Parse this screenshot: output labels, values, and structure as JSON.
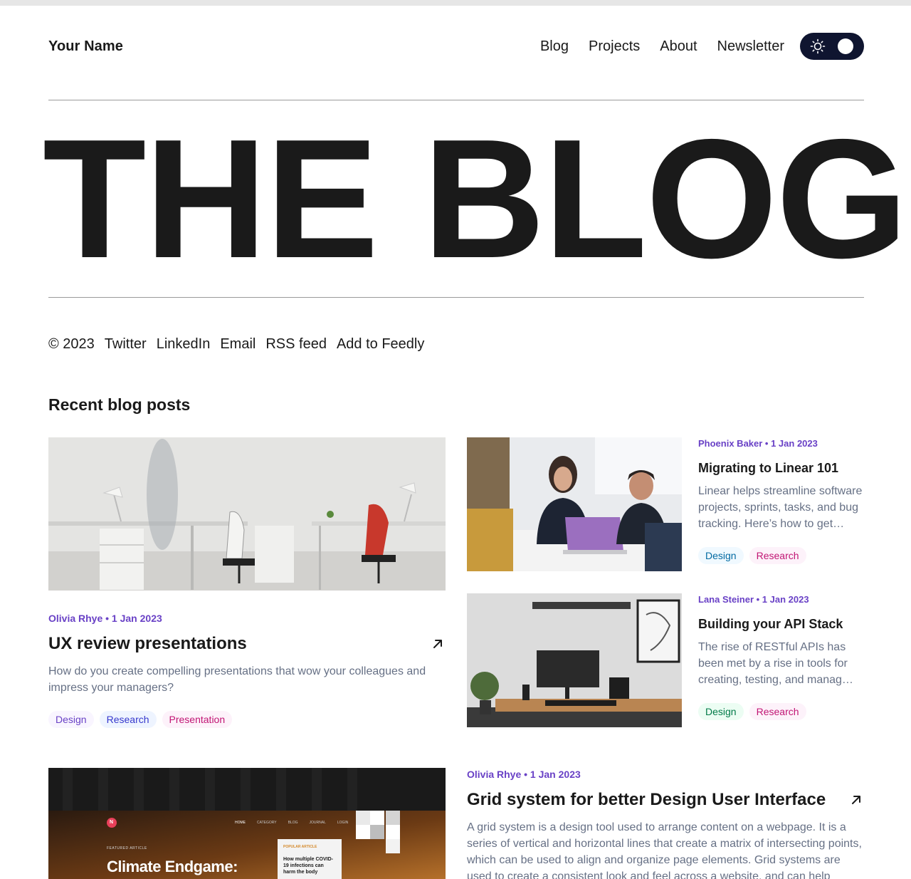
{
  "header": {
    "brand": "Your Name",
    "nav": [
      "Blog",
      "Projects",
      "About",
      "Newsletter"
    ],
    "theme_toggle_icon": "sun-icon"
  },
  "hero": {
    "title": "THE BLOG"
  },
  "social": {
    "copyright": "© 2023",
    "links": [
      "Twitter",
      "LinkedIn",
      "Email",
      "RSS feed",
      "Add to Feedly"
    ]
  },
  "section_title": "Recent blog posts",
  "posts": [
    {
      "meta": "Olivia Rhye • 1 Jan 2023",
      "title": "UX review presentations",
      "excerpt": "How do you create compelling presentations that wow your colleagues and impress your managers?",
      "tags": [
        "Design",
        "Research",
        "Presentation"
      ]
    },
    {
      "meta": "Phoenix Baker • 1 Jan 2023",
      "title": "Migrating to Linear 101",
      "excerpt": "Linear helps streamline software projects, sprints, tasks, and bug tracking. Here’s how to get…",
      "tags": [
        "Design",
        "Research"
      ]
    },
    {
      "meta": "Lana Steiner • 1 Jan 2023",
      "title": "Building your API Stack",
      "excerpt": "The rise of RESTful APIs has been met by a rise in tools for creating, testing, and manag…",
      "tags": [
        "Design",
        "Research"
      ]
    },
    {
      "meta": "Olivia Rhye • 1 Jan 2023",
      "title": "Grid system for better Design User Interface",
      "excerpt": "A grid system is a design tool used to arrange content on a webpage. It is a series of vertical and horizontal lines that create a matrix of intersecting points, which can be used to align and organize page elements. Grid systems are used to create a consistent look and feel across a website, and can help",
      "image_text": {
        "heading": "Climate Endgame:",
        "featured": "FEATURED ARTICLE",
        "popular": "POPULAR ARTICLE",
        "card": "How multiple COVID-19 infections can harm the body",
        "nav": [
          "HOME",
          "CATEGORY",
          "BLOG",
          "JOURNAL",
          "LOGIN"
        ]
      }
    }
  ],
  "colors": {
    "meta": "#6941c6",
    "excerpt": "#667085",
    "toggle_bg": "#0f1530"
  }
}
